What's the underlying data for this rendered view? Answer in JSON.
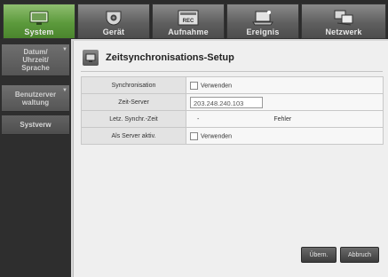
{
  "tabs": [
    {
      "label": "System",
      "icon": "monitor-icon",
      "active": true
    },
    {
      "label": "Gerät",
      "icon": "camera-icon",
      "active": false
    },
    {
      "label": "Aufnahme",
      "icon": "rec-icon",
      "active": false
    },
    {
      "label": "Ereignis",
      "icon": "laptop-icon",
      "active": false
    },
    {
      "label": "Netzwerk",
      "icon": "network-icon",
      "active": false
    }
  ],
  "sidebar": {
    "items": [
      {
        "label": "Datum/ Uhrzeit/ Sprache",
        "selected": false
      },
      {
        "label": "Benutzerver waltung",
        "selected": false
      },
      {
        "label": "Systverw",
        "selected": true
      }
    ]
  },
  "panel": {
    "title": "Zeitsynchronisations-Setup",
    "icon": "settings-panel-icon",
    "rows": [
      {
        "label": "Synchronisation",
        "checkbox": "Verwenden"
      },
      {
        "label": "Zeit-Server",
        "value": "203.248.240.103"
      },
      {
        "label": "Letz. Synchr.-Zeit",
        "value": "-",
        "status": "Fehler"
      },
      {
        "label": "Als Server aktiv.",
        "checkbox": "Verwenden"
      }
    ]
  },
  "buttons": {
    "apply": "Übern.",
    "cancel": "Abbruch"
  },
  "colors": {
    "active_tab": "#5c9a3c",
    "tab": "#5f5f5f",
    "sidebar": "#2e2e2e",
    "panel": "#efefef"
  }
}
